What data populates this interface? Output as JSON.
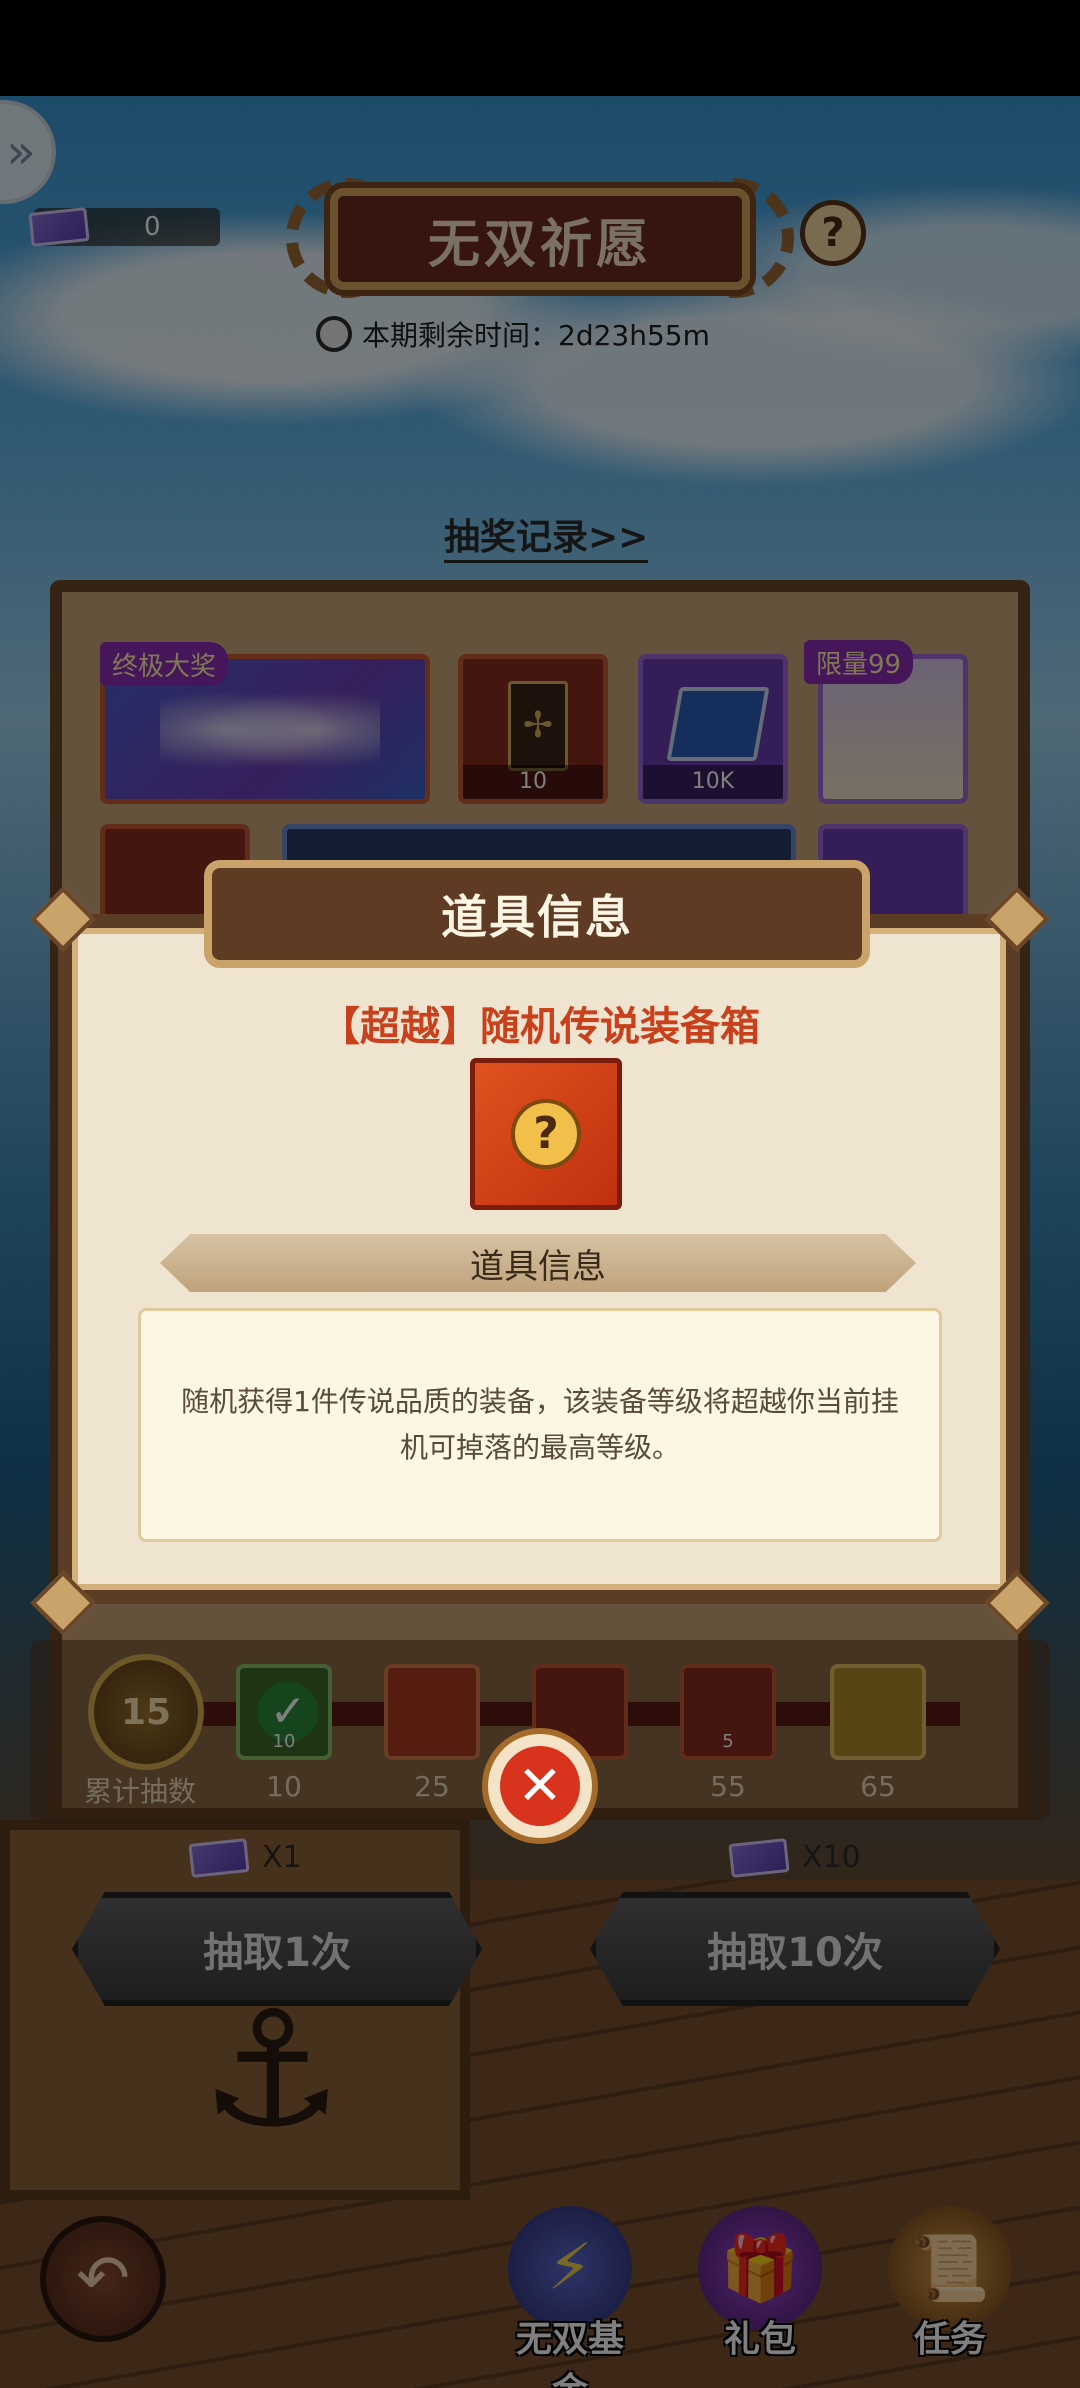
{
  "header": {
    "title": "无双祈愿",
    "ticket_count": "0",
    "timer_text": "本期剩余时间：2d23h55m",
    "help_label": "?",
    "records_link": "抽奖记录>>"
  },
  "prizes": {
    "grand_tag": "终极大奖",
    "limited_tag": "限量99",
    "card_count": "10",
    "book_count": "10K"
  },
  "milestones": {
    "current_count": "15",
    "count_label": "累计抽数",
    "items": [
      {
        "label": "10",
        "badge": "10"
      },
      {
        "label": "25",
        "badge": ""
      },
      {
        "label": "",
        "badge": ""
      },
      {
        "label": "55",
        "badge": "5"
      },
      {
        "label": "65",
        "badge": ""
      }
    ]
  },
  "draw": {
    "single_cost": "X1",
    "ten_cost": "X10",
    "single_label": "抽取1次",
    "ten_label": "抽取10次"
  },
  "modal": {
    "title": "道具信息",
    "item_name": "【超越】随机传说装备箱",
    "section_title": "道具信息",
    "description": "随机获得1件传说品质的装备，该装备等级将超越你当前挂机可掉落的最高等级。",
    "close_symbol": "✕"
  },
  "bottom_nav": {
    "back_symbol": "↶",
    "items": [
      {
        "label": "无双基金",
        "icon": "fund-icon"
      },
      {
        "label": "礼包",
        "icon": "gift-icon"
      },
      {
        "label": "任务",
        "icon": "task-scroll-icon"
      }
    ]
  },
  "colors": {
    "accent_red": "#c8401c",
    "title_plate": "#6a2a1b",
    "modal_bg": "#efe4cf"
  }
}
